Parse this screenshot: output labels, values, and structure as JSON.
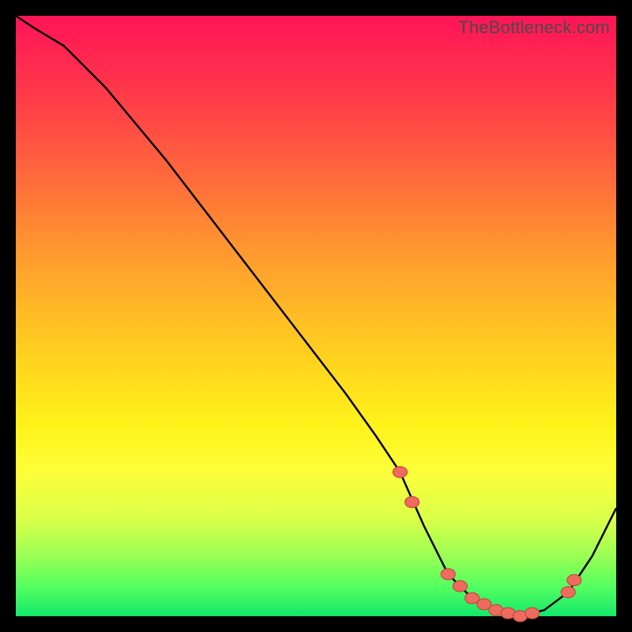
{
  "watermark": "TheBottleneck.com",
  "colors": {
    "frame_bg": "#000000",
    "marker_fill": "#ef6a5f",
    "marker_stroke": "#c44a3f",
    "curve": "#000000"
  },
  "chart_data": {
    "type": "line",
    "title": "",
    "xlabel": "",
    "ylabel": "",
    "xlim": [
      0,
      100
    ],
    "ylim": [
      0,
      100
    ],
    "series": [
      {
        "name": "bottleneck-curve",
        "x": [
          0,
          3,
          8,
          15,
          25,
          35,
          45,
          55,
          60,
          64,
          68,
          72,
          76,
          80,
          84,
          88,
          92,
          96,
          100
        ],
        "values": [
          100,
          98,
          95,
          88,
          76,
          63,
          50,
          37,
          30,
          24,
          15,
          7,
          3,
          1,
          0,
          1,
          4,
          10,
          18
        ]
      }
    ],
    "markers": {
      "name": "optimal-range",
      "x": [
        64,
        66,
        72,
        74,
        76,
        78,
        80,
        82,
        84,
        86,
        92,
        93
      ],
      "values": [
        24,
        19,
        7,
        5,
        3,
        2,
        1,
        0.5,
        0,
        0.5,
        4,
        6
      ]
    },
    "gradient_stops": [
      {
        "pos": 0,
        "color": "#ff1457"
      },
      {
        "pos": 18,
        "color": "#ff4a44"
      },
      {
        "pos": 38,
        "color": "#ff9430"
      },
      {
        "pos": 58,
        "color": "#ffd51f"
      },
      {
        "pos": 76,
        "color": "#fdff3a"
      },
      {
        "pos": 90,
        "color": "#9aff55"
      },
      {
        "pos": 100,
        "color": "#14e86a"
      }
    ]
  }
}
